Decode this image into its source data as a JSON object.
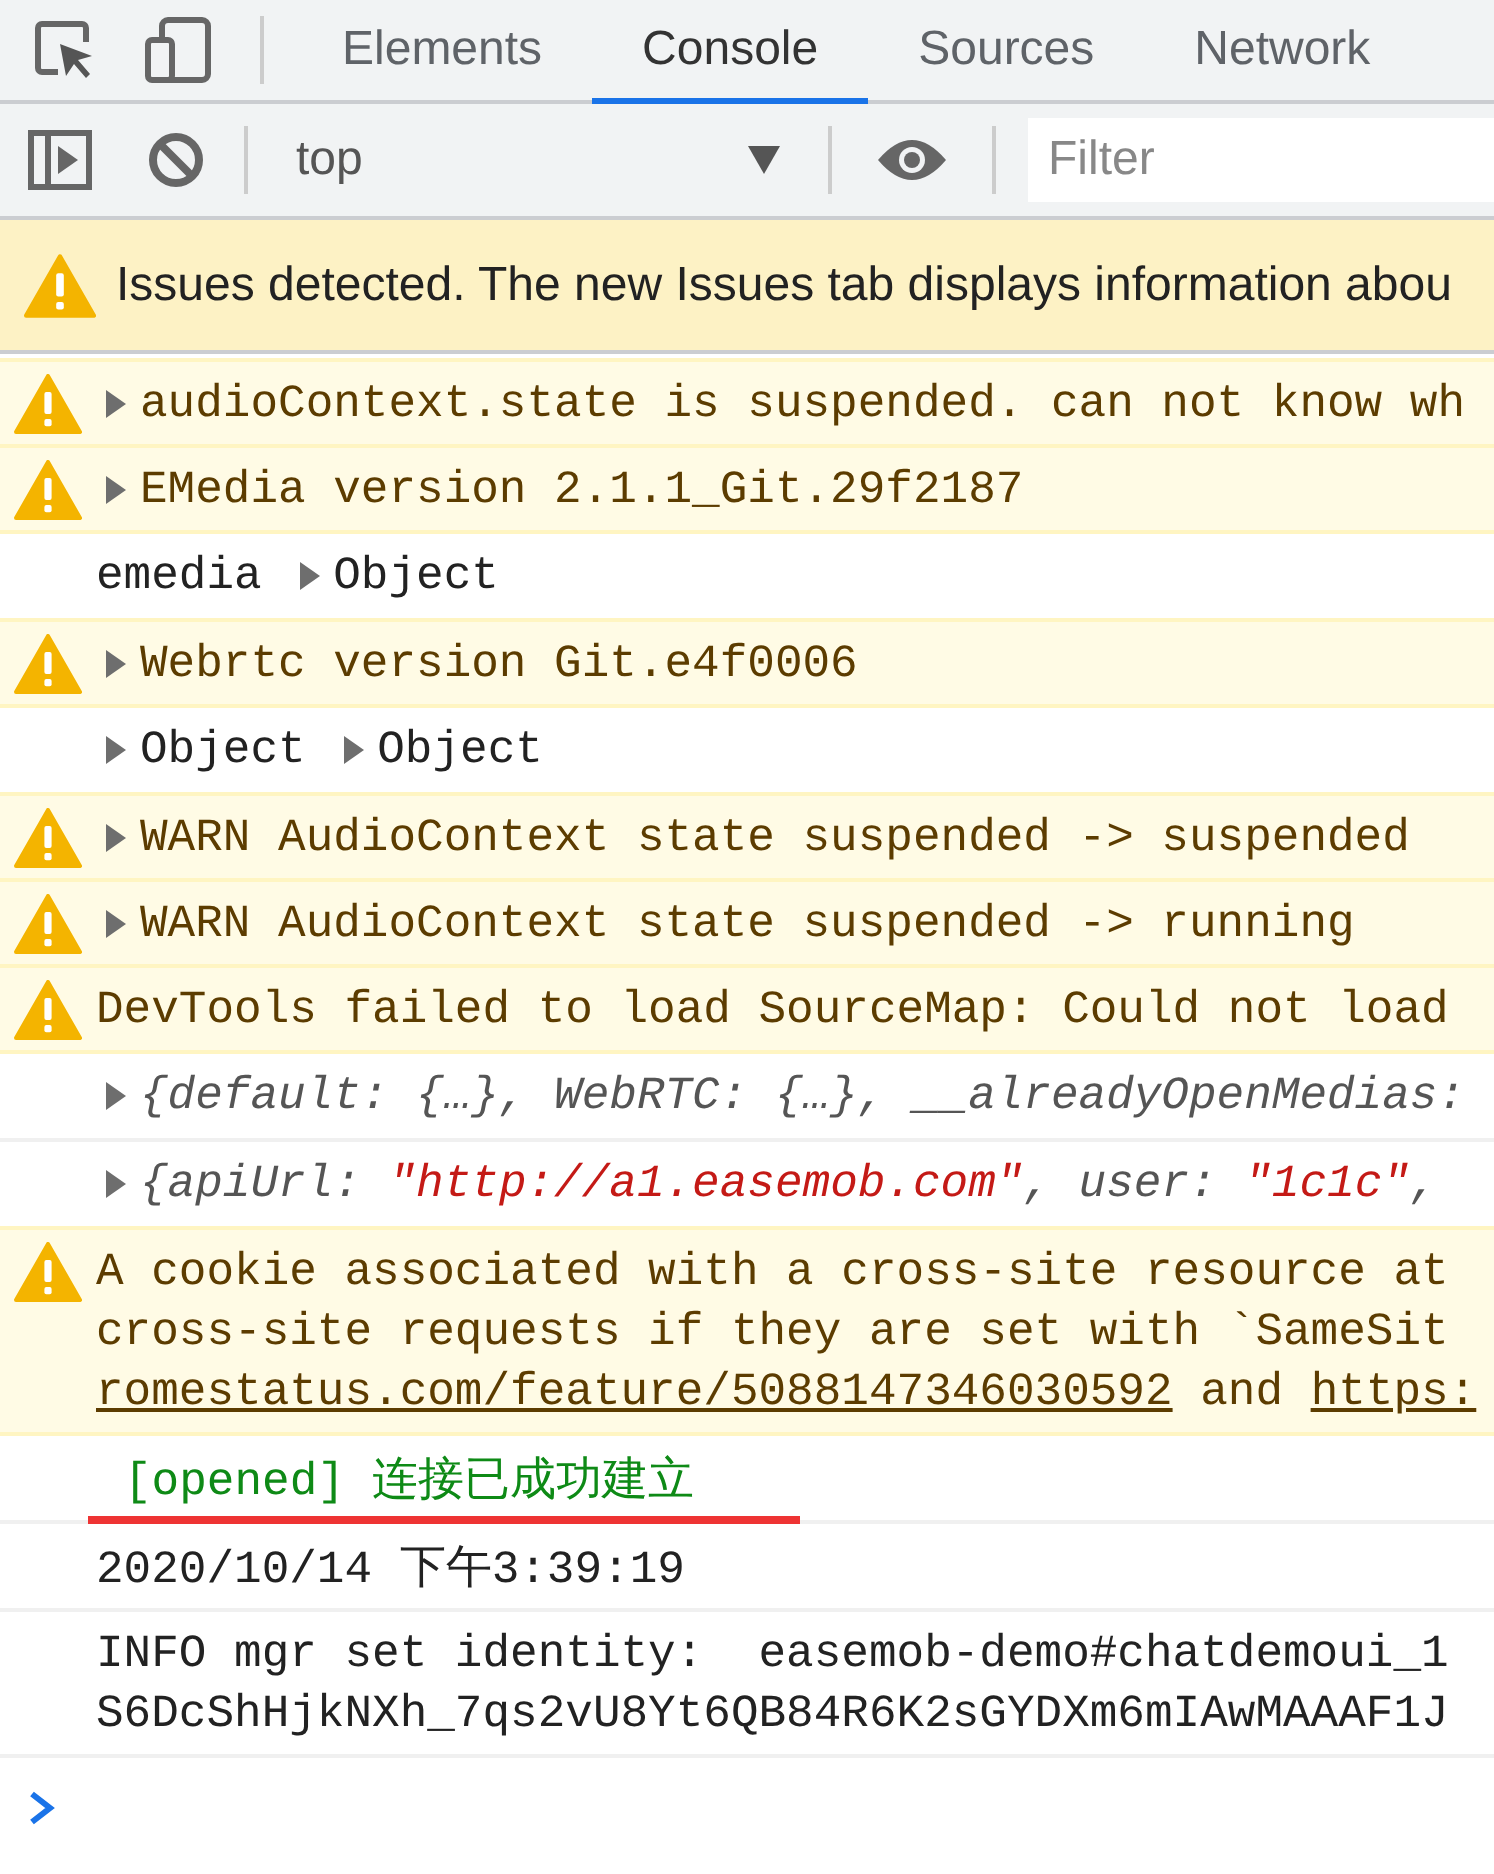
{
  "tabs": [
    {
      "label": "Elements",
      "selected": false
    },
    {
      "label": "Console",
      "selected": true
    },
    {
      "label": "Sources",
      "selected": false
    },
    {
      "label": "Network",
      "selected": false
    }
  ],
  "toolbar": {
    "context": "top",
    "filter": {
      "placeholder": "Filter"
    }
  },
  "issues_banner": {
    "text": "Issues detected. The new Issues tab displays information abou"
  },
  "messages": [
    {
      "kind": "warning",
      "lines": [
        [
          {
            "kind": "text",
            "toggle": true,
            "text": "audioContext.state is suspended. can not know wh"
          }
        ]
      ]
    },
    {
      "kind": "warning",
      "lines": [
        [
          {
            "kind": "text",
            "toggle": true,
            "text": "EMedia version 2.1.1_Git.29f2187"
          }
        ]
      ]
    },
    {
      "kind": "log",
      "lines": [
        [
          {
            "kind": "text",
            "toggle": false,
            "text": "emedia"
          },
          {
            "kind": "text",
            "toggle": true,
            "text": "Object"
          }
        ]
      ]
    },
    {
      "kind": "warning",
      "lines": [
        [
          {
            "kind": "text",
            "toggle": true,
            "text": "Webrtc version Git.e4f0006"
          }
        ]
      ]
    },
    {
      "kind": "log",
      "lines": [
        [
          {
            "kind": "text",
            "toggle": true,
            "text": "Object"
          },
          {
            "kind": "text",
            "toggle": true,
            "text": "Object"
          }
        ]
      ]
    },
    {
      "kind": "warning",
      "lines": [
        [
          {
            "kind": "text",
            "toggle": true,
            "text": "WARN AudioContext state suspended -> suspended"
          }
        ]
      ]
    },
    {
      "kind": "warning",
      "lines": [
        [
          {
            "kind": "text",
            "toggle": true,
            "text": "WARN AudioContext state suspended -> running"
          }
        ]
      ]
    },
    {
      "kind": "warning",
      "lines": [
        [
          {
            "kind": "text",
            "toggle": false,
            "text": "DevTools failed to load SourceMap: Could not load"
          }
        ]
      ]
    },
    {
      "kind": "log",
      "lines": [
        [
          {
            "kind": "preview",
            "toggle": true,
            "text": "{default: {…}, WebRTC: {…}, __alreadyOpenMedias:"
          }
        ]
      ]
    },
    {
      "kind": "log",
      "lines": [
        [
          {
            "kind": "preview",
            "toggle": true,
            "text": "{apiUrl: "
          },
          {
            "kind": "string",
            "toggle": false,
            "text": "\"http://a1.easemob.com\""
          },
          {
            "kind": "preview",
            "toggle": false,
            "text": ", user: "
          },
          {
            "kind": "string",
            "toggle": false,
            "text": "\"1c1c\""
          },
          {
            "kind": "preview",
            "toggle": false,
            "text": ","
          }
        ]
      ]
    },
    {
      "kind": "warning",
      "lines": [
        [
          {
            "kind": "text",
            "toggle": false,
            "text": "A cookie associated with a cross-site resource at"
          }
        ],
        [
          {
            "kind": "text",
            "toggle": false,
            "text": "cross-site requests if they are set with `SameSit"
          }
        ],
        [
          {
            "kind": "link",
            "toggle": false,
            "text": "romestatus.com/feature/5088147346030592"
          },
          {
            "kind": "text",
            "toggle": false,
            "text": "and"
          },
          {
            "kind": "link",
            "toggle": false,
            "text": "https:"
          }
        ]
      ]
    },
    {
      "kind": "log",
      "underlined": true,
      "lines": [
        [
          {
            "kind": "success",
            "toggle": false,
            "text": "[opened] 连接已成功建立"
          }
        ]
      ]
    },
    {
      "kind": "log",
      "lines": [
        [
          {
            "kind": "text",
            "toggle": false,
            "text": "2020/10/14 下午3:39:19"
          }
        ]
      ]
    },
    {
      "kind": "log",
      "lines": [
        [
          {
            "kind": "text",
            "toggle": false,
            "text": "INFO mgr set identity:  easemob-demo#chatdemoui_1"
          }
        ],
        [
          {
            "kind": "text",
            "toggle": false,
            "text": "S6DcShHjkNXh_7qs2vU8Yt6QB84R6K2sGYDXm6mIAwMAAAF1J"
          }
        ]
      ]
    }
  ]
}
